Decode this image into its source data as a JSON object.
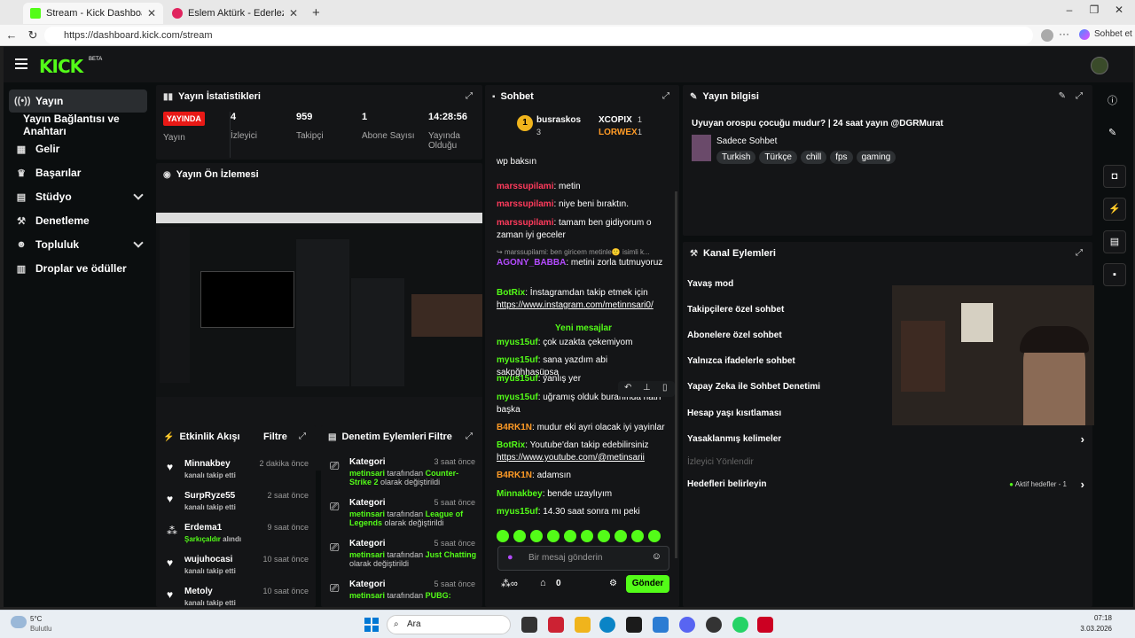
{
  "browser": {
    "tabs": [
      {
        "label": "Stream - Kick Dashboard",
        "active": true
      },
      {
        "label": "Eslem Aktürk - Ederlezi (Cover...",
        "active": false
      }
    ],
    "new_tab_icon": "plus-icon",
    "url": "https://dashboard.kick.com/stream",
    "profile_label": "Sohbet et"
  },
  "topnav": {
    "logo": "KICK",
    "beta": "BETA"
  },
  "sidebar": {
    "items": [
      {
        "label": "Yayın",
        "icon": "broadcast-icon",
        "selected": true
      },
      {
        "label": "Yayın Bağlantısı ve Anahtarı",
        "icon": "",
        "selected": false
      },
      {
        "label": "Gelir",
        "icon": "revenue-icon",
        "selected": false
      },
      {
        "label": "Başarılar",
        "icon": "trophy-icon",
        "selected": false
      },
      {
        "label": "Stüdyo",
        "icon": "studio-icon",
        "selected": false,
        "expandable": true
      },
      {
        "label": "Denetleme",
        "icon": "hammer-icon",
        "selected": false
      },
      {
        "label": "Topluluk",
        "icon": "people-icon",
        "selected": false,
        "expandable": true
      },
      {
        "label": "Droplar ve ödüller",
        "icon": "gift-icon",
        "selected": false
      }
    ]
  },
  "stats": {
    "title": "Yayın İstatistikleri",
    "columns": [
      {
        "value": "YAYINDA",
        "label": "Yayın"
      },
      {
        "value": "4",
        "label": "İzleyici"
      },
      {
        "value": "959",
        "label": "Takipçi"
      },
      {
        "value": "1",
        "label": "Abone Sayısı"
      },
      {
        "value": "14:28:56",
        "label": "Yayında Olduğu"
      }
    ]
  },
  "preview": {
    "title": "Yayın Ön İzlemesi"
  },
  "activity": {
    "title": "Etkinlik Akışı",
    "filter": "Filtre",
    "items": [
      {
        "name": "Minnakbey",
        "sub": "kanalı takip etti",
        "time": "2 dakika önce",
        "icon": "heart-icon"
      },
      {
        "name": "SurpRyze55",
        "sub": "kanalı takip etti",
        "time": "2 saat önce",
        "icon": "heart-icon"
      },
      {
        "name": "Erdema1",
        "sub_highlight": "Şarkıçaldır",
        "sub": "alındı",
        "time": "9 saat önce",
        "icon": "redeem-icon"
      },
      {
        "name": "wujuhocasi",
        "sub": "kanalı takip etti",
        "time": "10 saat önce",
        "icon": "heart-icon"
      },
      {
        "name": "Metoly",
        "sub": "kanalı takip etti",
        "time": "10 saat önce",
        "icon": "heart-icon"
      }
    ]
  },
  "mod_actions": {
    "title": "Denetim Eylemleri",
    "filter": "Filtre",
    "items": [
      {
        "title": "Kategori",
        "time": "3 saat önce",
        "user": "metinsari",
        "mid": "tarafından",
        "target": "Counter-Strike 2",
        "end": "olarak değiştirildi"
      },
      {
        "title": "Kategori",
        "time": "5 saat önce",
        "user": "metinsari",
        "mid": "tarafından",
        "target": "League of Legends",
        "end": "olarak değiştirildi"
      },
      {
        "title": "Kategori",
        "time": "5 saat önce",
        "user": "metinsari",
        "mid": "tarafından",
        "target": "Just Chatting",
        "end": "olarak değiştirildi"
      },
      {
        "title": "Kategori",
        "time": "5 saat önce",
        "user": "metinsari",
        "mid": "tarafından",
        "target": "PUBG:",
        "end": ""
      }
    ]
  },
  "chat": {
    "title": "Sohbet",
    "top_gifter": {
      "name": "busraskos",
      "rank": "1",
      "count": "3"
    },
    "gifters": [
      {
        "name": "XCOPIX",
        "count": "1"
      },
      {
        "name": "LORWEX",
        "count": "1"
      }
    ],
    "messages": [
      {
        "user": "marssupilami",
        "text": "wp baksın",
        "color": "red"
      },
      {
        "user": "marssupilami",
        "text": "metin",
        "color": "red"
      },
      {
        "user": "marssupilami",
        "text": "niye beni bıraktın.",
        "color": "red"
      },
      {
        "user": "marssupilami",
        "text": "tamam ben gidiyorum o zaman iyi geceler",
        "color": "red"
      },
      {
        "reply": "marssupilami: ben giricem metinle🙂 isimli k..."
      },
      {
        "user": "AGONY_BABBA",
        "text": "metini zorla tutmuyoruz",
        "color": "purple"
      },
      {
        "user": "BotRix",
        "text": "İnstagramdan takip etmek için",
        "link": "https://www.instagram.com/metinnsari0/",
        "color": "green"
      }
    ],
    "new_messages": "Yeni mesajlar",
    "new_messages_list": [
      {
        "user": "myus15uf",
        "text": "çok uzakta çekemiyom",
        "color": "green"
      },
      {
        "user": "myus15uf",
        "text": "sana yazdım abi sakpğhhasüpsa",
        "color": "green"
      },
      {
        "user": "myus15uf",
        "text": "yanlış yer",
        "color": "green"
      },
      {
        "user": "myus15uf",
        "text": "uğramış olduk buranında hatrı başka",
        "color": "green"
      },
      {
        "user": "B4RK1N",
        "text": "mudur eki ayri olacak iyi yayinlar",
        "color": "orange"
      },
      {
        "user": "BotRix",
        "text": "Youtube'dan takip edebilirsiniz",
        "link": "https://www.youtube.com/@metinsarii",
        "color": "green"
      },
      {
        "user": "B4RK1N",
        "text": "adamsın",
        "color": "orange"
      },
      {
        "user": "Minnakbey",
        "text": "bende uzaylıyım",
        "color": "green"
      },
      {
        "user": "myus15uf",
        "text": "14.30 saat sonra mı peki",
        "color": "green"
      }
    ],
    "input_placeholder": "Bir mesaj gönderin",
    "points": "0",
    "send": "Gönder"
  },
  "stream_info": {
    "title": "Yayın bilgisi",
    "stream_title": "Uyuyan orospu çocuğu mudur? | 24 saat yayın @DGRMurat",
    "category": "Sadece Sohbet",
    "tags": [
      "Turkish",
      "Türkçe",
      "chill",
      "fps",
      "gaming"
    ]
  },
  "channel_actions": {
    "title": "Kanal Eylemleri",
    "items": [
      {
        "label": "Yavaş mod",
        "disabled": false
      },
      {
        "label": "Takipçilere özel sohbet",
        "disabled": false
      },
      {
        "label": "Abonelere özel sohbet",
        "disabled": false
      },
      {
        "label": "Yalnızca ifadelerle sohbet",
        "disabled": false
      },
      {
        "label": "Yapay Zeka ile Sohbet Denetimi",
        "disabled": false
      },
      {
        "label": "Hesap yaşı kısıtlaması",
        "disabled": false
      },
      {
        "label": "Yasaklanmış kelimeler",
        "disabled": false
      },
      {
        "label": "İzleyici Yönlendir",
        "disabled": true
      },
      {
        "label": "Hedefleri belirleyin",
        "disabled": false,
        "badge": "Aktif hedefler - 1"
      }
    ]
  },
  "taskbar": {
    "weather_temp": "5°C",
    "weather_desc": "Bulutlu",
    "search": "Ara",
    "time": "07:18",
    "date": "3.03.2026"
  },
  "colors": {
    "accent": "#53fc18",
    "live": "#e91916",
    "bg": "#0b0e0f",
    "panel": "#141517"
  }
}
